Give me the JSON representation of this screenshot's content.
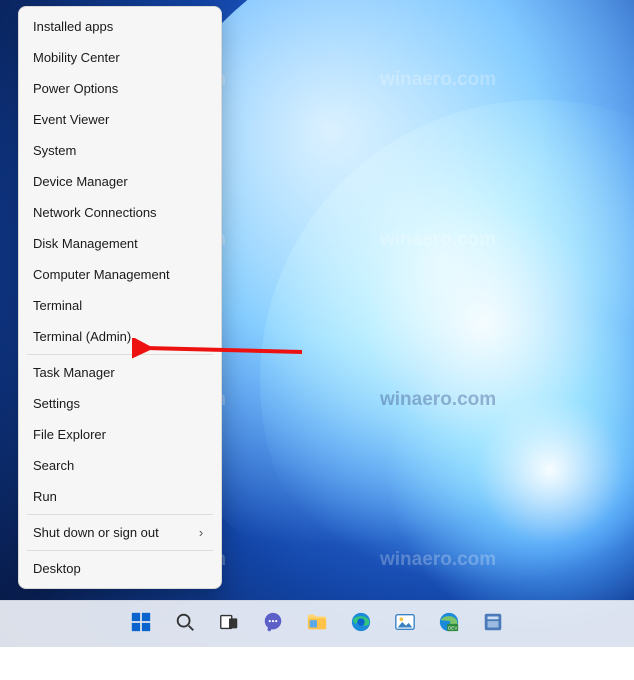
{
  "menu": {
    "groups": [
      [
        {
          "id": "installed-apps",
          "label": "Installed apps",
          "submenu": false
        },
        {
          "id": "mobility-center",
          "label": "Mobility Center",
          "submenu": false
        },
        {
          "id": "power-options",
          "label": "Power Options",
          "submenu": false
        },
        {
          "id": "event-viewer",
          "label": "Event Viewer",
          "submenu": false
        },
        {
          "id": "system",
          "label": "System",
          "submenu": false
        },
        {
          "id": "device-manager",
          "label": "Device Manager",
          "submenu": false
        },
        {
          "id": "network-connections",
          "label": "Network Connections",
          "submenu": false
        },
        {
          "id": "disk-management",
          "label": "Disk Management",
          "submenu": false
        },
        {
          "id": "computer-management",
          "label": "Computer Management",
          "submenu": false
        },
        {
          "id": "terminal",
          "label": "Terminal",
          "submenu": false
        },
        {
          "id": "terminal-admin",
          "label": "Terminal (Admin)",
          "submenu": false
        }
      ],
      [
        {
          "id": "task-manager",
          "label": "Task Manager",
          "submenu": false
        },
        {
          "id": "settings",
          "label": "Settings",
          "submenu": false
        },
        {
          "id": "file-explorer",
          "label": "File Explorer",
          "submenu": false
        },
        {
          "id": "search",
          "label": "Search",
          "submenu": false
        },
        {
          "id": "run",
          "label": "Run",
          "submenu": false
        }
      ],
      [
        {
          "id": "shut-down-or-sign-out",
          "label": "Shut down or sign out",
          "submenu": true
        }
      ],
      [
        {
          "id": "desktop",
          "label": "Desktop",
          "submenu": false
        }
      ]
    ]
  },
  "highlight_target": "terminal-admin",
  "watermark_text": "winaero.com",
  "taskbar": {
    "items": [
      {
        "id": "start",
        "name": "start-button",
        "icon": "windows-icon"
      },
      {
        "id": "search",
        "name": "search-button",
        "icon": "search-icon"
      },
      {
        "id": "taskview",
        "name": "task-view-button",
        "icon": "taskview-icon"
      },
      {
        "id": "chat",
        "name": "chat-button",
        "icon": "chat-icon"
      },
      {
        "id": "explorer",
        "name": "file-explorer-button",
        "icon": "folder-icon"
      },
      {
        "id": "edge",
        "name": "edge-button",
        "icon": "edge-icon"
      },
      {
        "id": "photos",
        "name": "photos-button",
        "icon": "photos-icon"
      },
      {
        "id": "edge-dev",
        "name": "edge-dev-button",
        "icon": "edge-dev-icon"
      },
      {
        "id": "app",
        "name": "app-button",
        "icon": "generic-app-icon"
      }
    ]
  }
}
